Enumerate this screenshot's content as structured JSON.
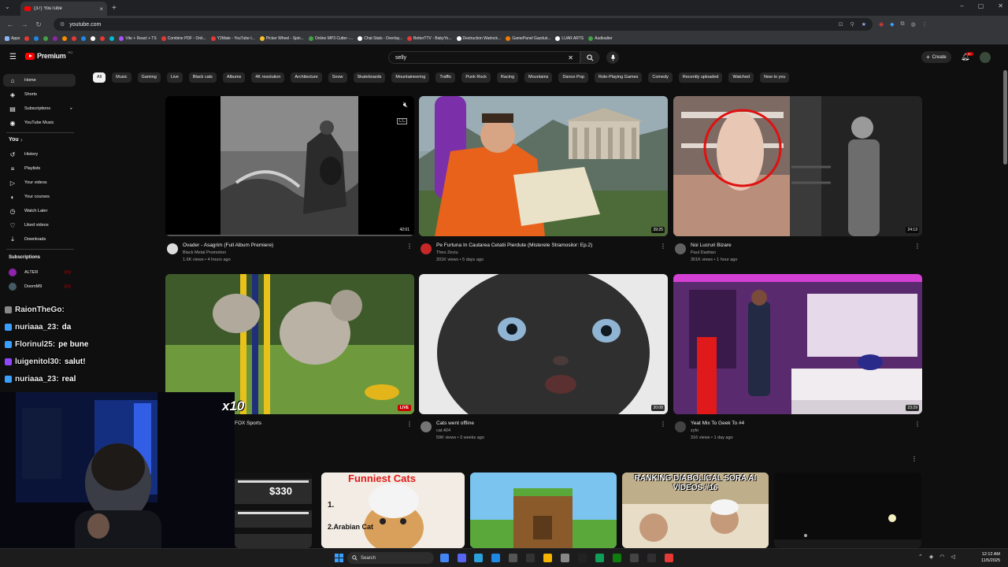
{
  "browser": {
    "tab_title": "(37) YouTube",
    "url": "youtube.com",
    "bookmarks": [
      {
        "label": "Apps",
        "color": "#8ab4f8"
      },
      {
        "label": "Vite + React + TS",
        "color": "#a855f7"
      },
      {
        "label": "Combine PDF - Onli...",
        "color": "#e53935"
      },
      {
        "label": "Y2Mate - YouTube t...",
        "color": "#e53935"
      },
      {
        "label": "Picker Wheel - Spin...",
        "color": "#fbc02d"
      },
      {
        "label": "Online MP3 Cutter -...",
        "color": "#43a047"
      },
      {
        "label": "Chat Stats - Overlay...",
        "color": "#ffffff"
      },
      {
        "label": "BetterTTV - BabyYo...",
        "color": "#e53935"
      },
      {
        "label": "Destruction Warlock...",
        "color": "#ffffff"
      },
      {
        "label": "GamePanel Gazduir...",
        "color": "#f57c00"
      },
      {
        "label": "LUAR ARTS",
        "color": "#ffffff"
      },
      {
        "label": "Audioalter",
        "color": "#43a047"
      }
    ]
  },
  "header": {
    "logo_text": "Premium",
    "logo_country": "RO",
    "search_value": "selly",
    "create_label": "Create",
    "notif_count": "9+"
  },
  "sidebar": {
    "main": [
      {
        "label": "Home",
        "icon": "home-icon",
        "glyph": "⌂"
      },
      {
        "label": "Shorts",
        "icon": "shorts-icon",
        "glyph": "◈"
      },
      {
        "label": "Subscriptions",
        "icon": "subscriptions-icon",
        "glyph": "▤"
      },
      {
        "label": "YouTube Music",
        "icon": "music-icon",
        "glyph": "◉"
      }
    ],
    "you_header": "You",
    "you": [
      {
        "label": "History",
        "icon": "history-icon",
        "glyph": "↺"
      },
      {
        "label": "Playlists",
        "icon": "playlists-icon",
        "glyph": "≡"
      },
      {
        "label": "Your videos",
        "icon": "your-videos-icon",
        "glyph": "▷"
      },
      {
        "label": "Your courses",
        "icon": "courses-icon",
        "glyph": "◐"
      },
      {
        "label": "Watch Later",
        "icon": "watch-later-icon",
        "glyph": "◷"
      },
      {
        "label": "Liked videos",
        "icon": "liked-icon",
        "glyph": "♡"
      },
      {
        "label": "Downloads",
        "icon": "downloads-icon",
        "glyph": "⤓"
      }
    ],
    "subs_header": "Subscriptions",
    "subs": [
      {
        "label": "ALTER",
        "color": "#8e24aa"
      },
      {
        "label": "DoomM9",
        "color": "#455a64"
      }
    ]
  },
  "chips": [
    "All",
    "Music",
    "Gaming",
    "Live",
    "Black cats",
    "Albums",
    "4K resolution",
    "Architecture",
    "Snow",
    "Skateboards",
    "Mountaineering",
    "Traffic",
    "Punk Rock",
    "Racing",
    "Mountains",
    "Dance-Pop",
    "Role-Playing Games",
    "Comedy",
    "Recently uploaded",
    "Watched",
    "New to you"
  ],
  "videos": [
    {
      "title": "Ovader - Asagrim (Full Album Premiere)",
      "channel": "Black Metal Promotion",
      "stats": "1.6K views • 4 hours ago",
      "duration": "42:01",
      "avatar": "#dddddd"
    },
    {
      "title": "Pe Furtuna In Cautarea Cetatii Pierdute (Misterele Stramosilor: Ep.2)",
      "channel": "Theo Zeciu",
      "stats": "201K views • 5 days ago",
      "duration": "39:25",
      "avatar": "#c62828"
    },
    {
      "title": "Noi Lucruri Bizare",
      "channel": "Paul Dadrian",
      "stats": "301K views • 1 hour ago",
      "duration": "24:13",
      "avatar": "#616161"
    },
    {
      "title": "Agility Championship | FOX Sports",
      "channel": "",
      "stats": "",
      "duration": "LIVE",
      "avatar": "#1565c0"
    },
    {
      "title": "Cats went offline",
      "channel": "cat.404",
      "stats": "59K views • 3 weeks ago",
      "duration": "20:08",
      "avatar": "#757575"
    },
    {
      "title": "Yeat Mix To Geek To #4",
      "channel": "zyfo",
      "stats": "316 views • 1 day ago",
      "duration": "23:29",
      "avatar": "#424242"
    }
  ],
  "shorts": [
    {
      "text": "$330"
    },
    {
      "text": "Funniest Cats",
      "sub1": "1.",
      "sub2": "2.Arabian Cat"
    },
    {
      "text": ""
    },
    {
      "text": "RANKING DIABOLICAL SORA AI VIDEOS #16"
    },
    {
      "text": ""
    }
  ],
  "chat": [
    {
      "name": "RaionTheGo:",
      "msg": "",
      "badge": "#888888"
    },
    {
      "name": "nuriaaa_23:",
      "msg": "da",
      "badge": "#3aa0ff"
    },
    {
      "name": "Florinul25:",
      "msg": "pe bune",
      "badge": "#3aa0ff"
    },
    {
      "name": "luigenitol30:",
      "msg": "salut!",
      "badge": "#9146ff"
    },
    {
      "name": "nuriaaa_23:",
      "msg": "real",
      "badge": "#3aa0ff"
    }
  ],
  "overlay_multiplier": "x10",
  "taskbar": {
    "search_label": "Search",
    "time": "12:12 AM",
    "date": "11/5/2025"
  }
}
